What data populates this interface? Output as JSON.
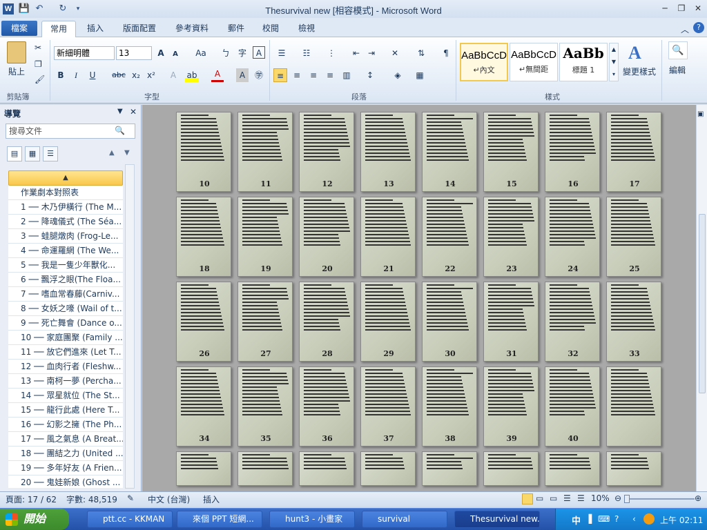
{
  "window": {
    "title": "Thesurvival new [相容模式] - Microsoft Word",
    "app_icon": "W"
  },
  "tabs": {
    "file": "檔案",
    "items": [
      "常用",
      "插入",
      "版面配置",
      "參考資料",
      "郵件",
      "校閱",
      "檢視"
    ],
    "active": "常用"
  },
  "ribbon": {
    "clipboard": {
      "paste": "貼上",
      "label": "剪貼簿"
    },
    "font": {
      "name": "新細明體",
      "size": "13",
      "label": "字型",
      "bold": "B",
      "italic": "I",
      "underline": "U",
      "strike": "abc",
      "sub": "x₂",
      "sup": "x²",
      "grow": "A",
      "shrink": "A",
      "case": "Aa"
    },
    "paragraph": {
      "label": "段落"
    },
    "styles": {
      "label": "樣式",
      "items": [
        {
          "sample": "AaBbCcD",
          "name": "↵內文"
        },
        {
          "sample": "AaBbCcD",
          "name": "↵無間距"
        },
        {
          "sample": "AaBb",
          "name": "標題 1"
        }
      ],
      "change": "變更樣式"
    },
    "editing": {
      "label": "編輯"
    }
  },
  "nav": {
    "title": "導覽",
    "search_placeholder": "搜尋文件",
    "items": [
      "作業劇本對照表",
      "1 ── 木乃伊橫行 (The M...",
      "2 ── 降魂儀式 (The Séa...",
      "3 ── 蛙腿燉肉 (Frog-Le...",
      "4 ── 命運羅網 (The We...",
      "5 ── 我是一隻少年獸化...",
      "6 ── 飄浮之眼(The Floa...",
      "7 ── 嗜血常春藤(Carniv...",
      "8 ── 女妖之嚎 (Wail of t...",
      "9 ── 死亡舞會 (Dance o...",
      "10 ── 家庭團聚 (Family ...",
      "11 ── 放它們進來 (Let T...",
      "12 ── 血肉行者 (Fleshw...",
      "13 ── 南柯一夢 (Percha...",
      "14 ── 眾星就位 (The St...",
      "15 ── 龍行此處 (Here T...",
      "16 ── 幻影之擁 (The Ph...",
      "17 ── 風之氣息 (A Breat...",
      "18 ── 團結之力 (United ...",
      "19 ── 多年好友 (A Frien...",
      "20 ── 鬼娃新娘 (Ghost ..."
    ]
  },
  "pages": {
    "rows": [
      [
        "10",
        "11",
        "12",
        "13",
        "14",
        "15",
        "16",
        "17"
      ],
      [
        "18",
        "19",
        "20",
        "21",
        "22",
        "23",
        "24",
        "25"
      ],
      [
        "26",
        "27",
        "28",
        "29",
        "30",
        "31",
        "32",
        "33"
      ],
      [
        "34",
        "35",
        "36",
        "37",
        "38",
        "39",
        "40",
        ""
      ],
      [
        "",
        "",
        "",
        "",
        "",
        "",
        "",
        ""
      ]
    ]
  },
  "status": {
    "page": "頁面: 17 / 62",
    "words": "字數: 48,519",
    "lang": "中文 (台灣)",
    "mode": "插入",
    "zoom": "10%"
  },
  "taskbar": {
    "start": "開始",
    "tasks": [
      "ptt.cc - KKMAN",
      "來個 PPT 短網...",
      "hunt3 - 小畫家",
      "survival",
      "Thesurvival new..."
    ],
    "time": "上午 02:11",
    "ime": "中"
  }
}
